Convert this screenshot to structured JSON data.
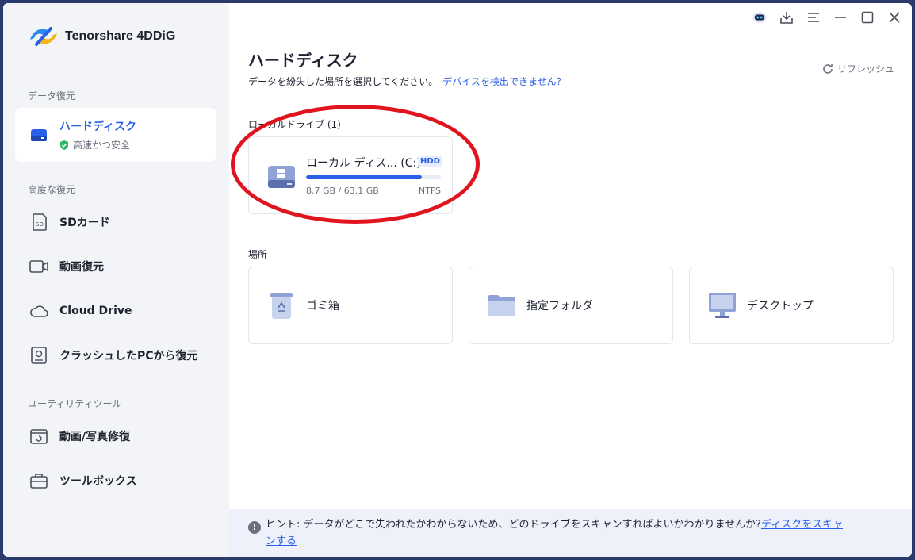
{
  "app": {
    "name": "Tenorshare 4DDiG"
  },
  "sidebar": {
    "sections": [
      {
        "title": "データ復元"
      },
      {
        "title": "高度な復元"
      },
      {
        "title": "ユーティリティツール"
      }
    ],
    "active": {
      "label": "ハードディスク",
      "sub": "高速かつ安全"
    },
    "items": [
      {
        "label": "SDカード",
        "icon": "sd-card-icon"
      },
      {
        "label": "動画復元",
        "icon": "video-camera-icon"
      },
      {
        "label": "Cloud Drive",
        "icon": "cloud-icon"
      },
      {
        "label": "クラッシュしたPCから復元",
        "icon": "crashed-pc-icon"
      },
      {
        "label": "動画/写真修復",
        "icon": "media-repair-icon"
      },
      {
        "label": "ツールボックス",
        "icon": "toolbox-icon"
      }
    ]
  },
  "main": {
    "title": "ハードディスク",
    "subtitle": "データを紛失した場所を選択してください。",
    "detect_link": "デバイスを検出できません?",
    "refresh": "リフレッシュ",
    "local_group": "ローカルドライブ (1)",
    "drive": {
      "name": "ローカル ディス... (C:)",
      "badge": "HDD",
      "size": "8.7 GB / 63.1 GB",
      "fs": "NTFS",
      "used_fraction": 0.86
    },
    "locations_group": "場所",
    "locations": [
      {
        "label": "ゴミ箱",
        "icon": "recycle-bin-icon"
      },
      {
        "label": "指定フォルダ",
        "icon": "folder-icon"
      },
      {
        "label": "デスクトップ",
        "icon": "desktop-monitor-icon"
      }
    ]
  },
  "hint": {
    "text": "ヒント: データがどこで失われたかわからないため、どのドライブをスキャンすればよいかわかりませんか?",
    "link_part1": "ディスクをスキャ",
    "link_part2": "ンする"
  },
  "colors": {
    "accent": "#2a5fe8",
    "highlight": "#e0141e"
  }
}
